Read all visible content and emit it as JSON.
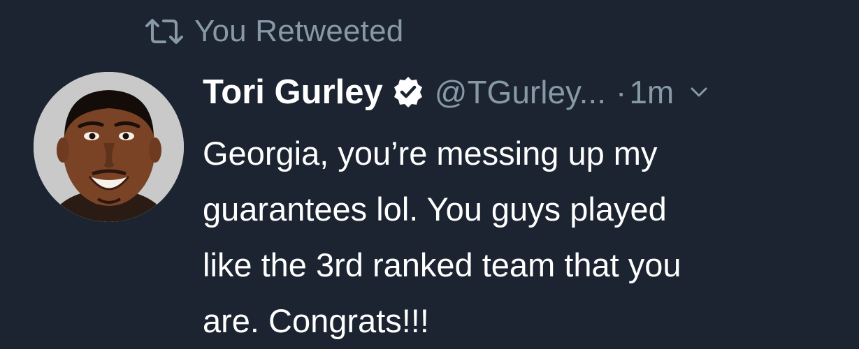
{
  "retweet": {
    "icon": "retweet-icon",
    "label": "You Retweeted"
  },
  "author": {
    "display_name": "Tori Gurley",
    "verified": true,
    "verified_icon": "verified-badge-icon",
    "handle": "@TGurley...",
    "separator": "·",
    "timestamp": "1m",
    "menu_icon": "chevron-down-icon"
  },
  "tweet": {
    "lines": [
      "Georgia, you’re messing up my",
      "guarantees lol. You guys played",
      "like the 3rd ranked team that you",
      "are. Congrats!!!"
    ]
  },
  "colors": {
    "background": "#1b2430",
    "primary_text": "#ffffff",
    "secondary_text": "#8899a6"
  }
}
